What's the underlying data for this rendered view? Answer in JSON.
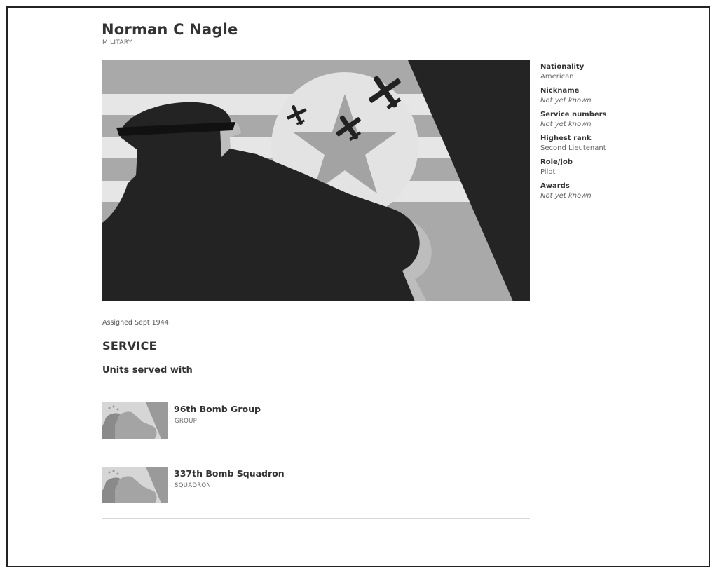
{
  "person": {
    "name": "Norman C Nagle",
    "category": "MILITARY"
  },
  "hero": {
    "caption": "Assigned Sept 1944"
  },
  "facts": [
    {
      "label": "Nationality",
      "value": "American",
      "unknown": false
    },
    {
      "label": "Nickname",
      "value": "Not yet known",
      "unknown": true
    },
    {
      "label": "Service numbers",
      "value": "Not yet known",
      "unknown": true
    },
    {
      "label": "Highest rank",
      "value": "Second Lieutenant",
      "unknown": false
    },
    {
      "label": "Role/job",
      "value": "Pilot",
      "unknown": false
    },
    {
      "label": "Awards",
      "value": "Not yet known",
      "unknown": true
    }
  ],
  "service": {
    "title": "SERVICE",
    "subtitle": "Units served with",
    "units": [
      {
        "name": "96th Bomb Group",
        "type": "GROUP"
      },
      {
        "name": "337th Bomb Squadron",
        "type": "SQUADRON"
      }
    ]
  }
}
